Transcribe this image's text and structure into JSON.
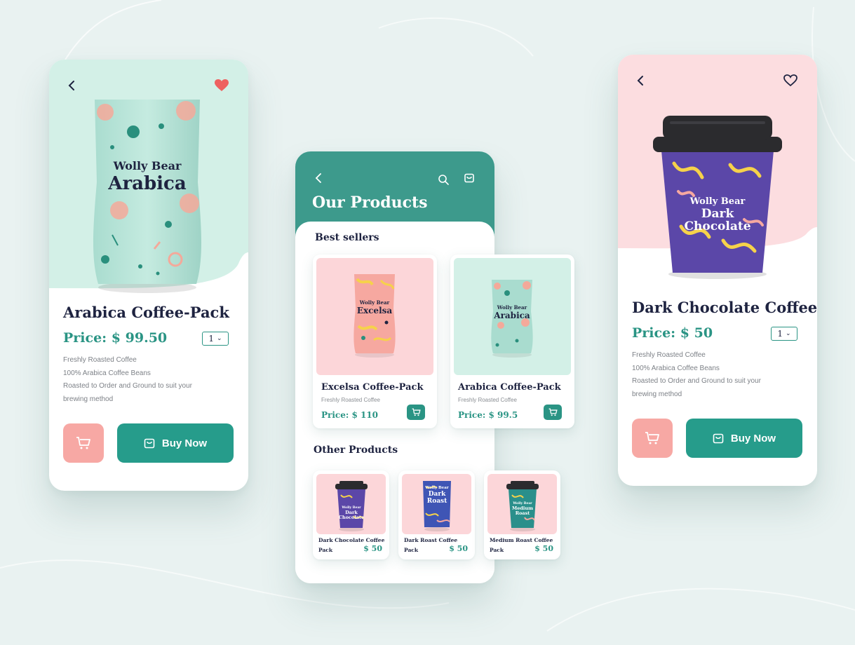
{
  "colors": {
    "teal": "#2a9484",
    "teal_header": "#3d9a8c",
    "mint": "#d3f0e7",
    "pink": "#fcdde0",
    "coral": "#f7a8a4",
    "heart_red": "#ee6160",
    "navy": "#1e2340",
    "cup_purple": "#5b47a8",
    "background": "#e9f2f1"
  },
  "left_screen": {
    "back_icon": "chevron-left-icon",
    "favorite_icon": "heart-filled-icon",
    "pack_brand": "Wolly Bear",
    "pack_name": "Arabica",
    "title": "Arabica Coffee-Pack",
    "price": "Price: $ 99.50",
    "quantity": "1",
    "description": [
      "Freshly Roasted Coffee",
      "100% Arabica Coffee Beans",
      "Roasted to Order and Ground to suit your",
      "brewing method"
    ],
    "cart_icon": "cart-icon",
    "buy_icon": "shopping-bag-icon",
    "buy_label": "Buy Now"
  },
  "middle_screen": {
    "back_icon": "chevron-left-icon",
    "search_icon": "search-icon",
    "bag_icon": "shopping-bag-icon",
    "title": "Our Products",
    "best_sellers_title": "Best sellers",
    "best_sellers": [
      {
        "pack_brand": "Wolly Bear",
        "pack_name": "Excelsa",
        "name": "Excelsa Coffee-Pack",
        "subtitle": "Freshly Roasted Coffee",
        "price": "Price: $ 110"
      },
      {
        "pack_brand": "Wolly Bear",
        "pack_name": "Arabica",
        "name": "Arabica Coffee-Pack",
        "subtitle": "Freshly Roasted Coffee",
        "price": "Price: $ 99.5"
      }
    ],
    "other_products_title": "Other Products",
    "other_products": [
      {
        "line1": "Dark Chocolate Coffee",
        "line2": "Pack",
        "price": "$ 50",
        "art_brand": "Wolly Bear",
        "art_name_1": "Dark",
        "art_name_2": "Chocolate"
      },
      {
        "line1": "Dark Roast Coffee",
        "line2": "Pack",
        "price": "$ 50",
        "art_brand": "Wolly Bear",
        "art_name_1": "Dark",
        "art_name_2": "Roast"
      },
      {
        "line1": "Medium Roast Coffee",
        "line2": "Pack",
        "price": "$ 50",
        "art_brand": "Wolly Bear",
        "art_name_1": "Medium",
        "art_name_2": "Roast"
      }
    ]
  },
  "right_screen": {
    "back_icon": "chevron-left-icon",
    "favorite_icon": "heart-outline-icon",
    "cup_brand": "Wolly Bear",
    "cup_name_1": "Dark",
    "cup_name_2": "Chocolate",
    "title": "Dark Chocolate Coffee",
    "price": "Price: $ 50",
    "quantity": "1",
    "description": [
      "Freshly Roasted Coffee",
      "100% Arabica Coffee Beans",
      "Roasted to Order and Ground to suit your",
      "brewing method"
    ],
    "cart_icon": "cart-icon",
    "buy_icon": "shopping-bag-icon",
    "buy_label": "Buy Now"
  }
}
